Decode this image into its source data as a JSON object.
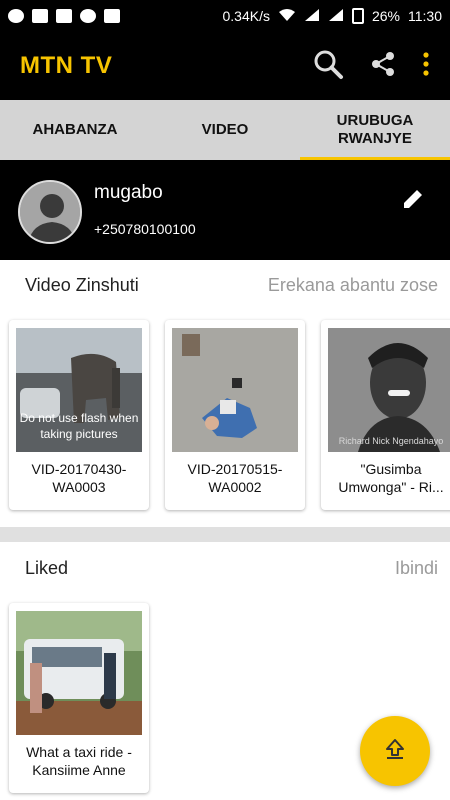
{
  "status_bar": {
    "speed": "0.34K/s",
    "battery": "26%",
    "time": "11:30"
  },
  "app_bar": {
    "title": "MTN TV",
    "icons": [
      "search-icon",
      "share-icon",
      "more-vert-icon"
    ]
  },
  "tabs": [
    {
      "label": "AHABANZA",
      "active": false
    },
    {
      "label": "VIDEO",
      "active": false
    },
    {
      "label": "URUBUGA\nRWANJYE",
      "active": true
    }
  ],
  "profile": {
    "name": "mugabo",
    "phone": "+250780100100"
  },
  "friends_videos": {
    "heading": "Video Zinshuti",
    "action": "Erekana abantu zose",
    "items": [
      {
        "caption": "VID-20170430-WA0003",
        "overlay": "Do not use flash when taking pictures"
      },
      {
        "caption": "VID-20170515-WA0002"
      },
      {
        "caption": "\"Gusimba Umwonga\" - Ri...",
        "watermark": "Richard Nick Ngendahayo"
      }
    ]
  },
  "liked": {
    "heading": "Liked",
    "action": "Ibindi",
    "items": [
      {
        "caption": "What a taxi ride - Kansiime Anne"
      }
    ]
  },
  "colors": {
    "accent": "#f7c400",
    "bar": "#000000",
    "tabs": "#d4d4d4"
  }
}
